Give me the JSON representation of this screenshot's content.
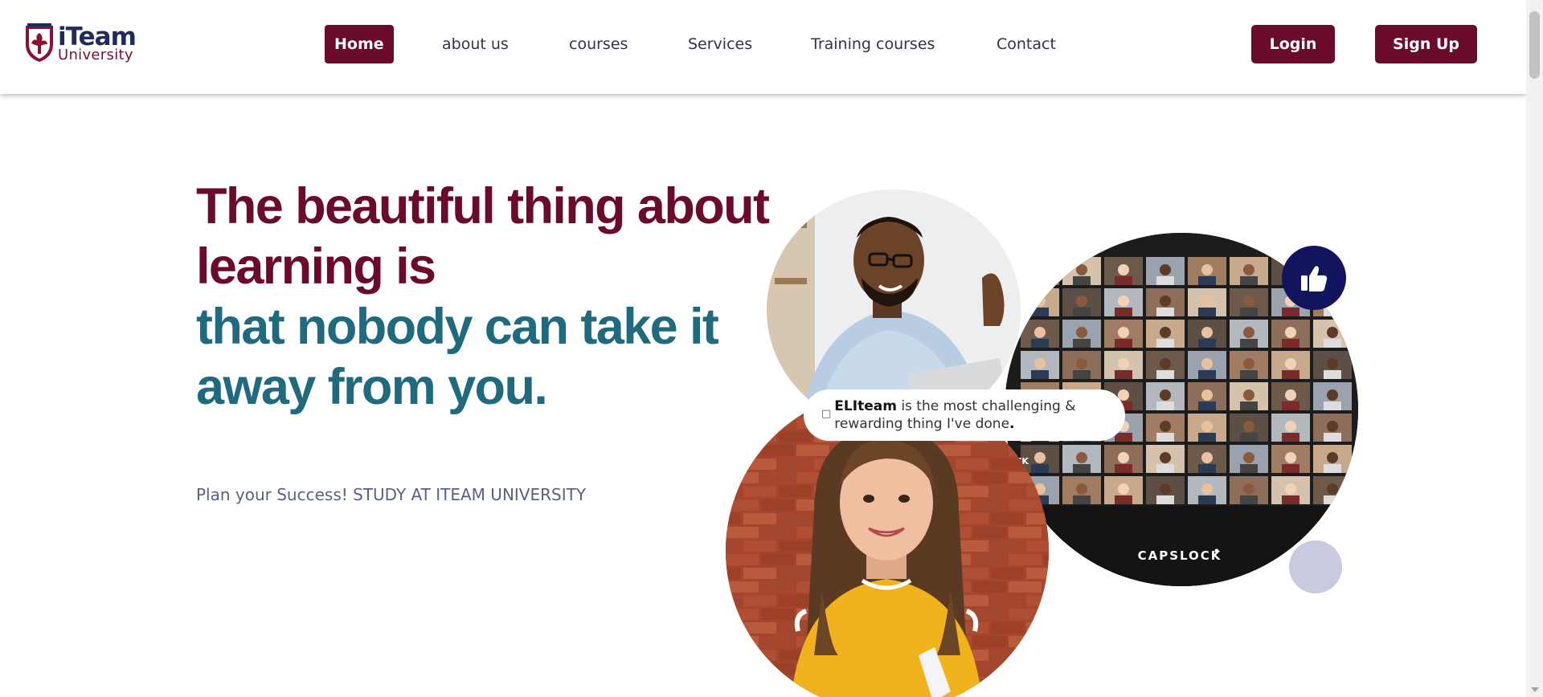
{
  "brand": {
    "name_main": "iTeam",
    "name_sub": "University",
    "colors": {
      "maroon": "#6b0a2d",
      "teal": "#1f6a7e",
      "navy": "#1f2b5a",
      "badge": "#12145e"
    }
  },
  "nav": {
    "items": [
      {
        "label": "Home",
        "active": true
      },
      {
        "label": "about us",
        "active": false
      },
      {
        "label": "courses",
        "active": false
      },
      {
        "label": "Services",
        "active": false
      },
      {
        "label": "Training courses",
        "active": false
      },
      {
        "label": "Contact",
        "active": false
      }
    ]
  },
  "auth": {
    "login_label": "Login",
    "signup_label": "Sign Up"
  },
  "hero": {
    "headline_line1": "The beautiful thing about learning is",
    "headline_line2": "that nobody can take it away from you.",
    "tagline": "Plan your Success! STUDY AT ITEAM UNIVERSITY",
    "quote": {
      "open_mark": "□",
      "brand": "ELIteam",
      "text": " is the most challenging & rewarding thing I've done",
      "end": "."
    },
    "zoom_caption": "CAPSLOCK",
    "zoom_side_label": "OCK",
    "icons": {
      "like": "thumbs-up-icon"
    }
  }
}
